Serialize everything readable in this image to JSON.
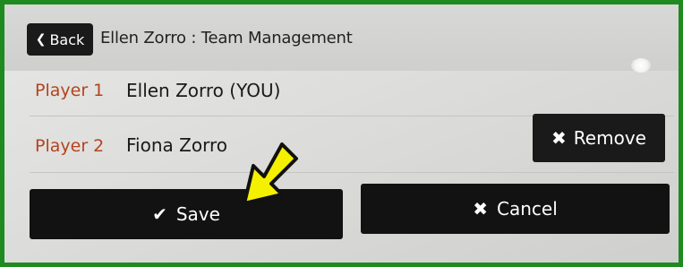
{
  "header": {
    "back_label": "Back",
    "title": "Ellen Zorro : Team Management"
  },
  "players": [
    {
      "label": "Player 1",
      "name": "Ellen Zorro (YOU)"
    },
    {
      "label": "Player 2",
      "name": "Fiona Zorro"
    }
  ],
  "actions": {
    "remove_label": "Remove",
    "save_label": "Save",
    "cancel_label": "Cancel"
  },
  "colors": {
    "frame_border": "#1f8a1f",
    "player_label": "#b3441f",
    "button_bg": "#121212",
    "pointer_arrow": "#f5f000"
  },
  "icons": {
    "back": "chevron-left-icon",
    "remove": "close-icon",
    "save": "check-icon",
    "cancel": "close-icon",
    "annotation": "pointer-arrow-icon"
  }
}
